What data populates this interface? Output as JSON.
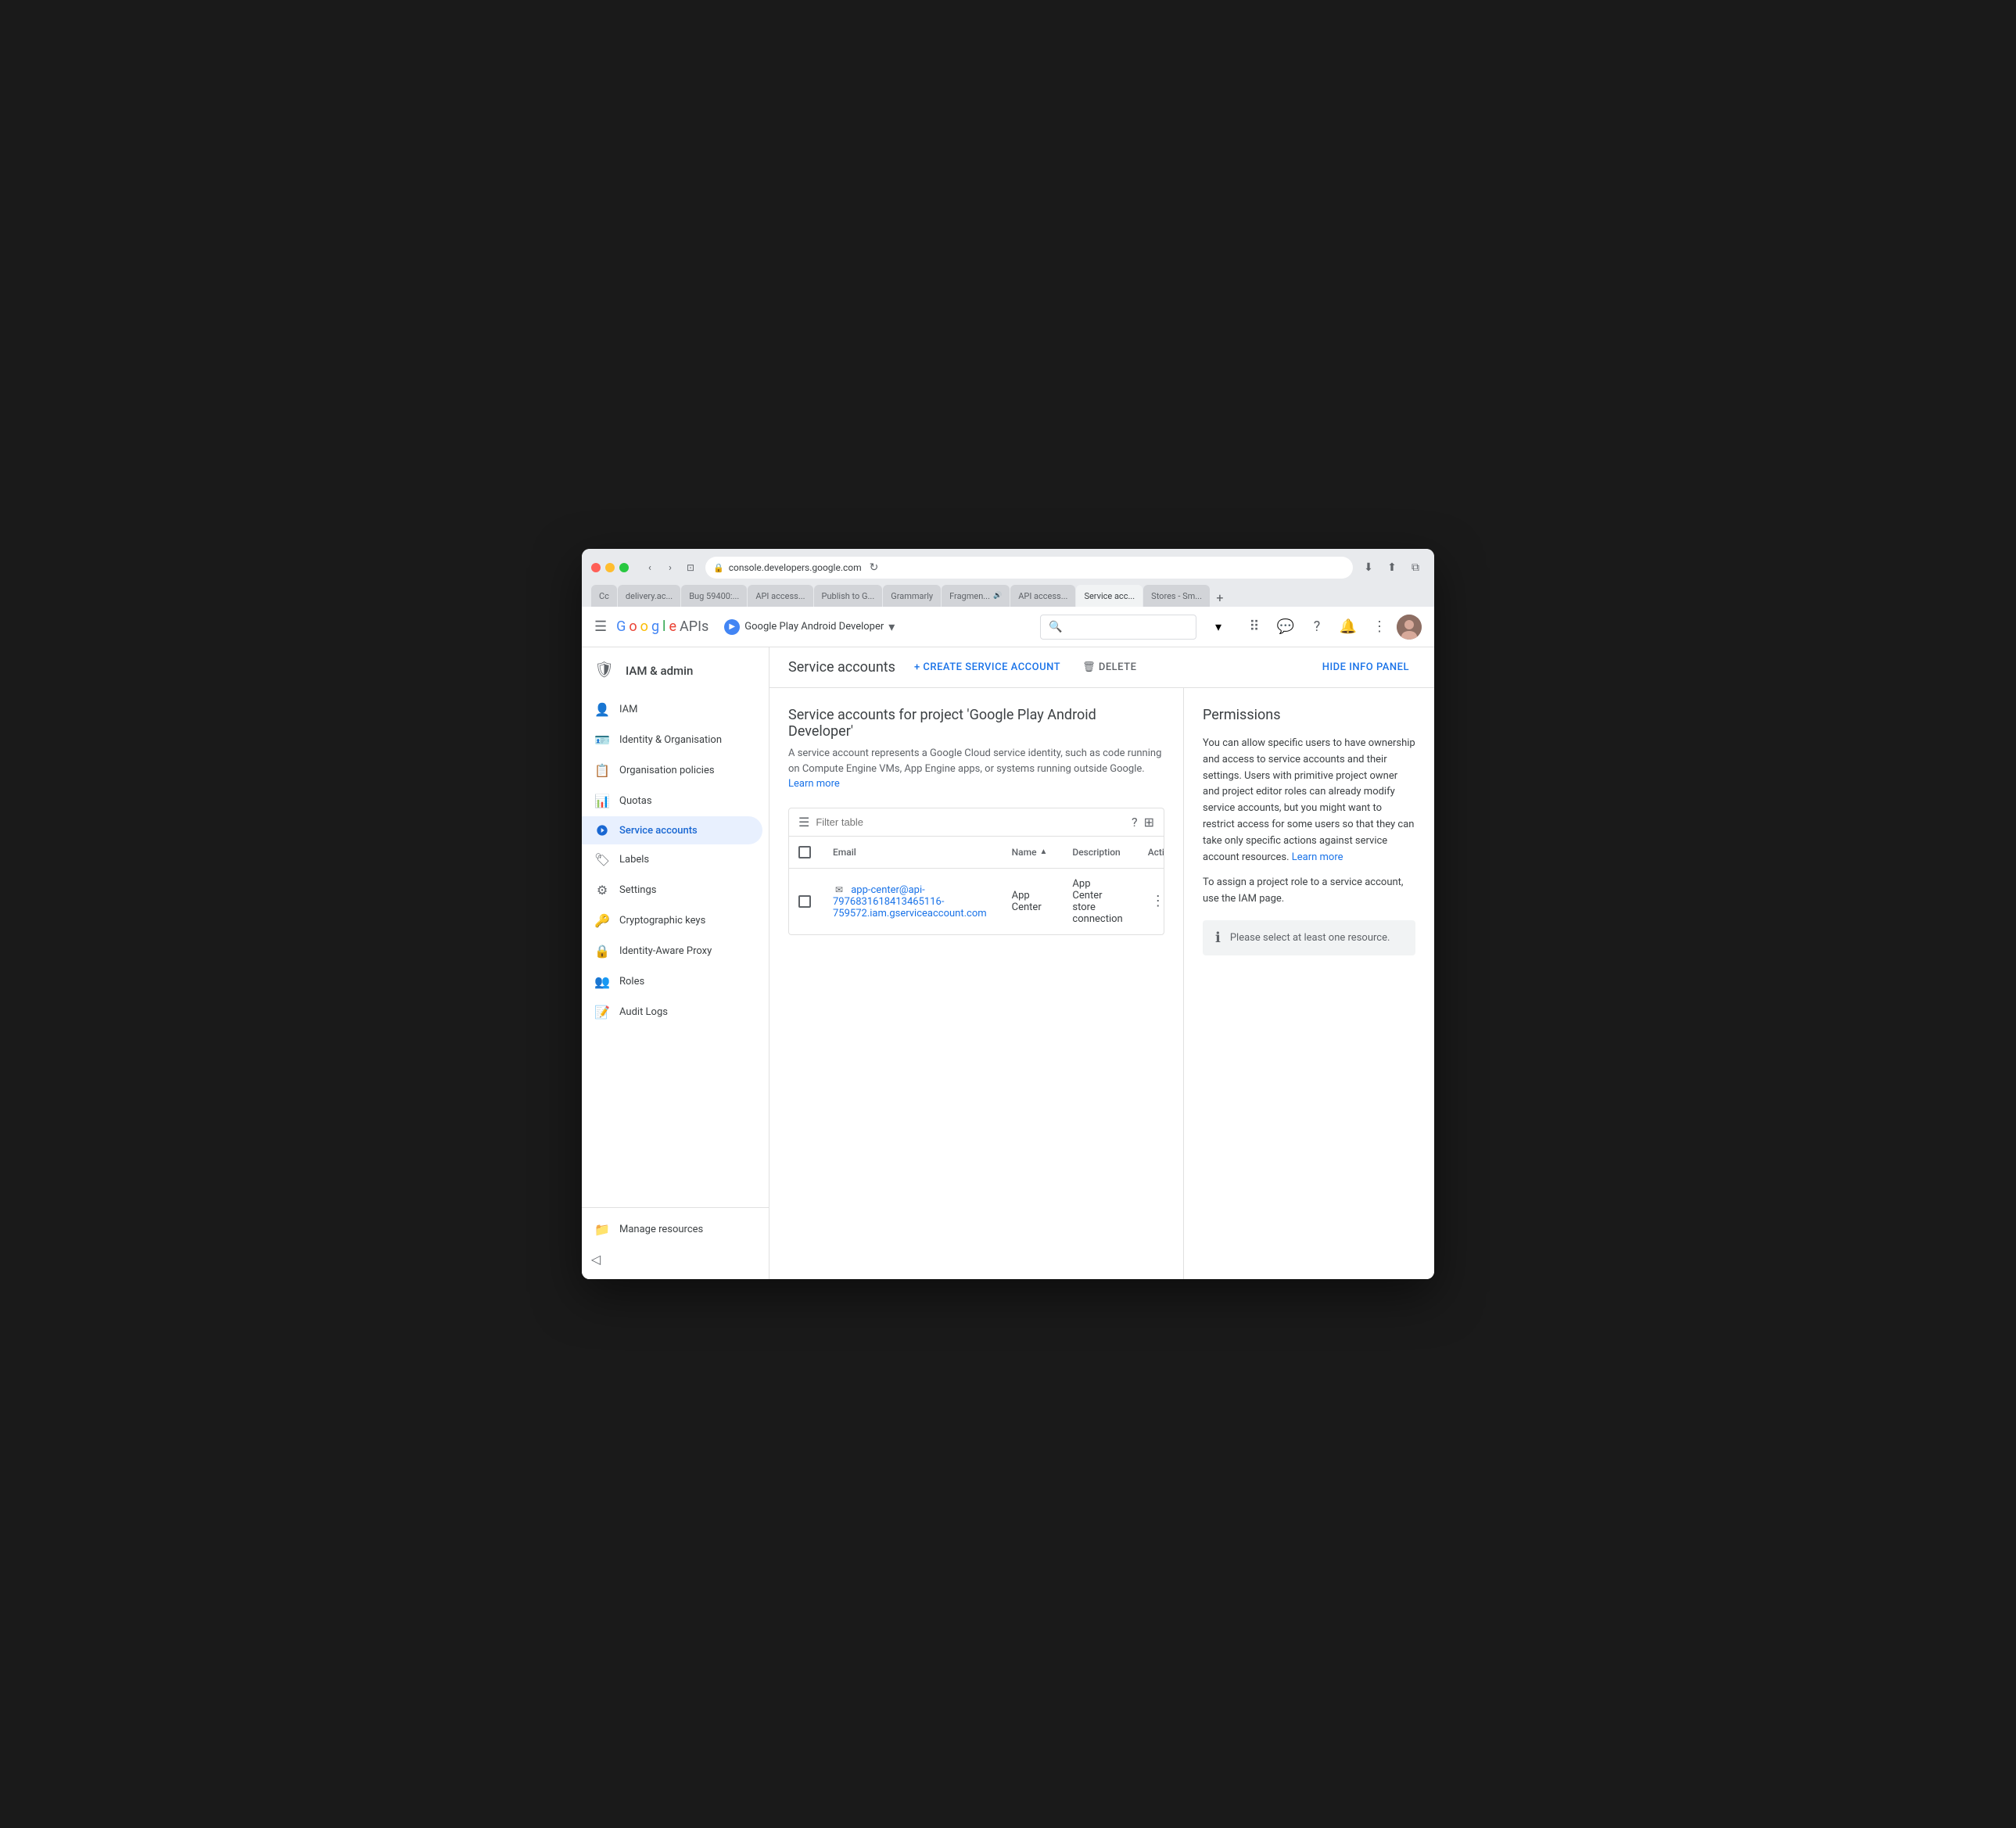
{
  "browser": {
    "url": "console.developers.google.com",
    "tabs": [
      {
        "id": "cc",
        "label": "Cc",
        "active": false
      },
      {
        "id": "delivery",
        "label": "delivery.ac...",
        "active": false
      },
      {
        "id": "bug",
        "label": "Bug 59400:...",
        "active": false
      },
      {
        "id": "api1",
        "label": "API access...",
        "active": false
      },
      {
        "id": "publish",
        "label": "Publish to G...",
        "active": false
      },
      {
        "id": "grammarly",
        "label": "Grammarly",
        "active": false
      },
      {
        "id": "fragment",
        "label": "Fragmen...",
        "active": false,
        "audio": true
      },
      {
        "id": "api2",
        "label": "API access...",
        "active": false
      },
      {
        "id": "service",
        "label": "Service acc...",
        "active": true
      },
      {
        "id": "stores",
        "label": "Stores - Sm...",
        "active": false
      }
    ]
  },
  "appBar": {
    "menu_icon": "☰",
    "google_text": "Google",
    "apis_text": "APIs",
    "project_name": "Google Play Android Developer",
    "dropdown_arrow": "▾",
    "search_placeholder": "Search",
    "reload_icon": "↻"
  },
  "sidebar": {
    "title": "IAM & admin",
    "shield_icon": "🛡",
    "items": [
      {
        "id": "iam",
        "label": "IAM",
        "icon": "👤"
      },
      {
        "id": "identity",
        "label": "Identity & Organisation",
        "icon": "🪪"
      },
      {
        "id": "org-policies",
        "label": "Organisation policies",
        "icon": "📋"
      },
      {
        "id": "quotas",
        "label": "Quotas",
        "icon": "📊"
      },
      {
        "id": "service-accounts",
        "label": "Service accounts",
        "icon": "⚙",
        "active": true
      },
      {
        "id": "labels",
        "label": "Labels",
        "icon": "🏷"
      },
      {
        "id": "settings",
        "label": "Settings",
        "icon": "⚙"
      },
      {
        "id": "cryptographic-keys",
        "label": "Cryptographic keys",
        "icon": "🔑"
      },
      {
        "id": "identity-aware-proxy",
        "label": "Identity-Aware Proxy",
        "icon": "🔒"
      },
      {
        "id": "roles",
        "label": "Roles",
        "icon": "👥"
      },
      {
        "id": "audit-logs",
        "label": "Audit Logs",
        "icon": "📝"
      }
    ],
    "bottom_items": [
      {
        "id": "manage-resources",
        "label": "Manage resources",
        "icon": "📁"
      }
    ],
    "collapse_icon": "◁"
  },
  "pageHeader": {
    "title": "Service accounts",
    "create_btn": "+ CREATE SERVICE ACCOUNT",
    "delete_btn": "🗑 DELETE",
    "hide_panel_btn": "HIDE INFO PANEL"
  },
  "mainContent": {
    "heading": "Service accounts for project 'Google Play Android Developer'",
    "description": "A service account represents a Google Cloud service identity, such as code running on Compute Engine VMs, App Engine apps, or systems running outside Google.",
    "learn_more": "Learn more",
    "filter_placeholder": "Filter table",
    "table": {
      "columns": [
        {
          "id": "checkbox",
          "label": ""
        },
        {
          "id": "email",
          "label": "Email"
        },
        {
          "id": "name",
          "label": "Name",
          "sortable": true
        },
        {
          "id": "description",
          "label": "Description"
        },
        {
          "id": "actions",
          "label": "Actions"
        }
      ],
      "rows": [
        {
          "email": "app-center@api-797683161841346511 6-759572.iam.gserviceaccount.com",
          "email_display": "app-center@api-797683161841346511 6-759572.iam.gserviceaccount.com",
          "email_short": "app-center@api-7976831618413465116-759572.iam.gserviceaccount.com",
          "name": "App Center",
          "description": "App Center store connection"
        }
      ]
    }
  },
  "infoPanel": {
    "title": "Permissions",
    "paragraph1": "You can allow specific users to have ownership and access to service accounts and their settings. Users with primitive project owner and project editor roles can already modify service accounts, but you might want to restrict access for some users so that they can take only specific actions against service account resources.",
    "learn_more": "Learn more",
    "paragraph2": "To assign a project role to a service account, use the IAM page.",
    "notice": "Please select at least one resource.",
    "notice_icon": "ℹ"
  }
}
